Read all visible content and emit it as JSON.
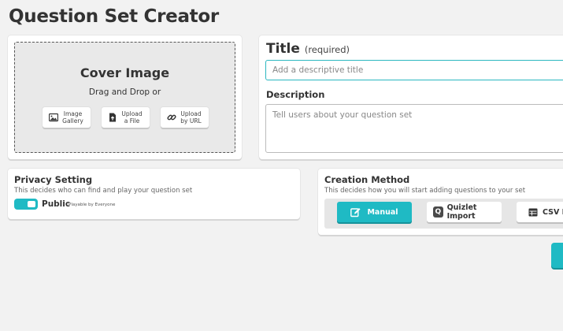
{
  "page": {
    "title": "Question Set Creator"
  },
  "cover": {
    "title": "Cover Image",
    "drag_text": "Drag and Drop or",
    "buttons": [
      {
        "label_line1": "Image",
        "label_line2": "Gallery",
        "icon": "image-icon"
      },
      {
        "label_line1": "Upload",
        "label_line2": "a File",
        "icon": "file-upload-icon"
      },
      {
        "label_line1": "Upload",
        "label_line2": "by URL",
        "icon": "link-icon"
      }
    ]
  },
  "title_field": {
    "label": "Title",
    "required_note": "(required)",
    "placeholder": "Add a descriptive title",
    "value": ""
  },
  "description_field": {
    "label": "Description",
    "placeholder": "Tell users about your question set",
    "value": ""
  },
  "privacy": {
    "title": "Privacy Setting",
    "subtitle": "This decides who can find and play your question set",
    "value": "Public",
    "note": "Playable by Everyone",
    "toggle_on": true
  },
  "creation": {
    "title": "Creation Method",
    "subtitle": "This decides how you will start adding questions to your set",
    "methods": [
      {
        "label": "Manual",
        "icon": "edit-icon",
        "selected": true
      },
      {
        "label": "Quizlet Import",
        "icon": "quizlet-icon",
        "logo_letter": "Q",
        "selected": false
      },
      {
        "label": "CSV Import",
        "icon": "table-icon",
        "selected": false
      }
    ]
  },
  "colors": {
    "accent": "#1fbac4",
    "background": "#f2f2f2"
  }
}
